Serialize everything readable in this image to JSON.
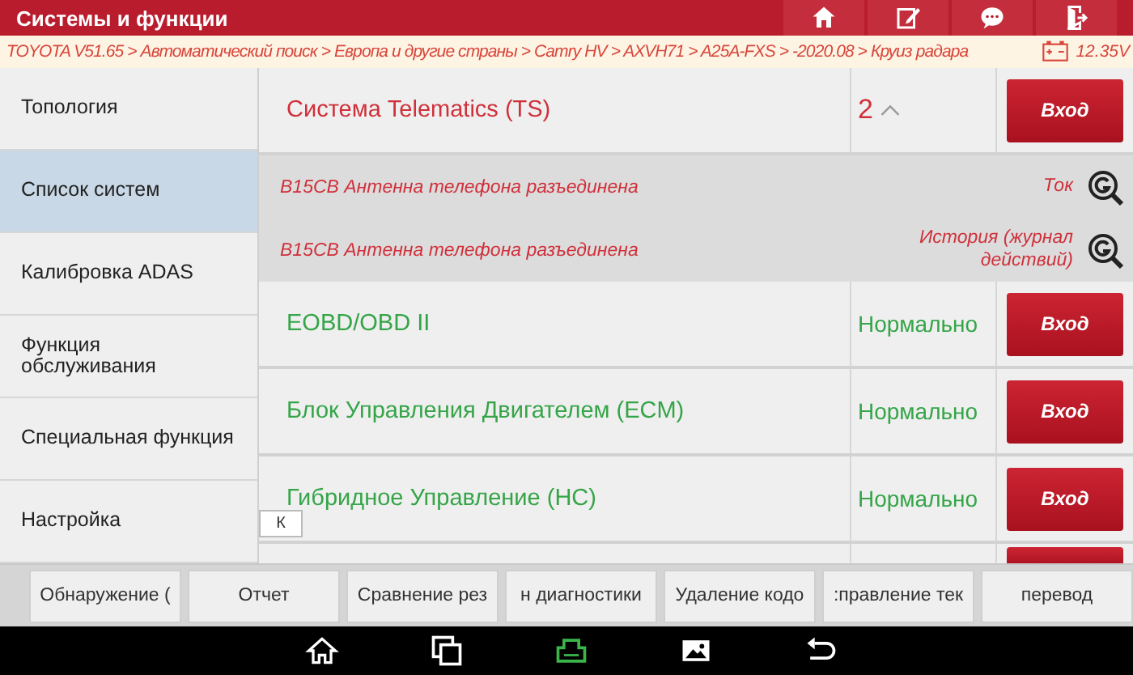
{
  "window": {
    "title": "Системы и функции"
  },
  "header_buttons": [
    {
      "kind": "home"
    },
    {
      "kind": "edit"
    },
    {
      "kind": "chat"
    },
    {
      "kind": "exit"
    }
  ],
  "breadcrumb": "TOYOTA V51.65 > Автоматический поиск > Европа и другие страны > Camry HV > AXVH71 > A25A-FXS > -2020.08 > Круиз радара",
  "voltage": "12.35V",
  "sidebar": {
    "items": [
      {
        "label": "Топология",
        "selected": false
      },
      {
        "label": "Список систем",
        "selected": true
      },
      {
        "label": "Калибровка ADAS",
        "selected": false
      },
      {
        "label": "Функция обслуживания",
        "selected": false
      },
      {
        "label": "Специальная функция",
        "selected": false
      },
      {
        "label": "Настройка",
        "selected": false
      }
    ]
  },
  "collapse_button": "К",
  "systems": [
    {
      "name": "Система Telematics (TS)",
      "kind": "fault",
      "count": "2",
      "expanded": true,
      "button": "Вход",
      "faults": [
        {
          "code": "B15CB Антенна телефона разъединена",
          "status": "Ток"
        },
        {
          "code": "B15CB Антенна телефона разъединена",
          "status": "История (журнал действий)"
        }
      ]
    },
    {
      "name": "EOBD/OBD II",
      "kind": "normal",
      "status": "Нормально",
      "button": "Вход"
    },
    {
      "name": "Блок Управления Двигателем (ECM)",
      "kind": "normal",
      "status": "Нормально",
      "button": "Вход"
    },
    {
      "name": "Гибридное Управление (HC)",
      "kind": "normal",
      "status": "Нормально",
      "button": "Вход"
    }
  ],
  "more_rows_below": true,
  "toolbar": [
    "Обнаружение (",
    "Отчет",
    "Сравнение рез",
    "н диагностики",
    "Удаление кодо",
    ":правление тек",
    "перевод"
  ],
  "nav_bar": [
    {
      "kind": "home"
    },
    {
      "kind": "recents"
    },
    {
      "kind": "vci"
    },
    {
      "kind": "gallery"
    },
    {
      "kind": "back"
    }
  ]
}
